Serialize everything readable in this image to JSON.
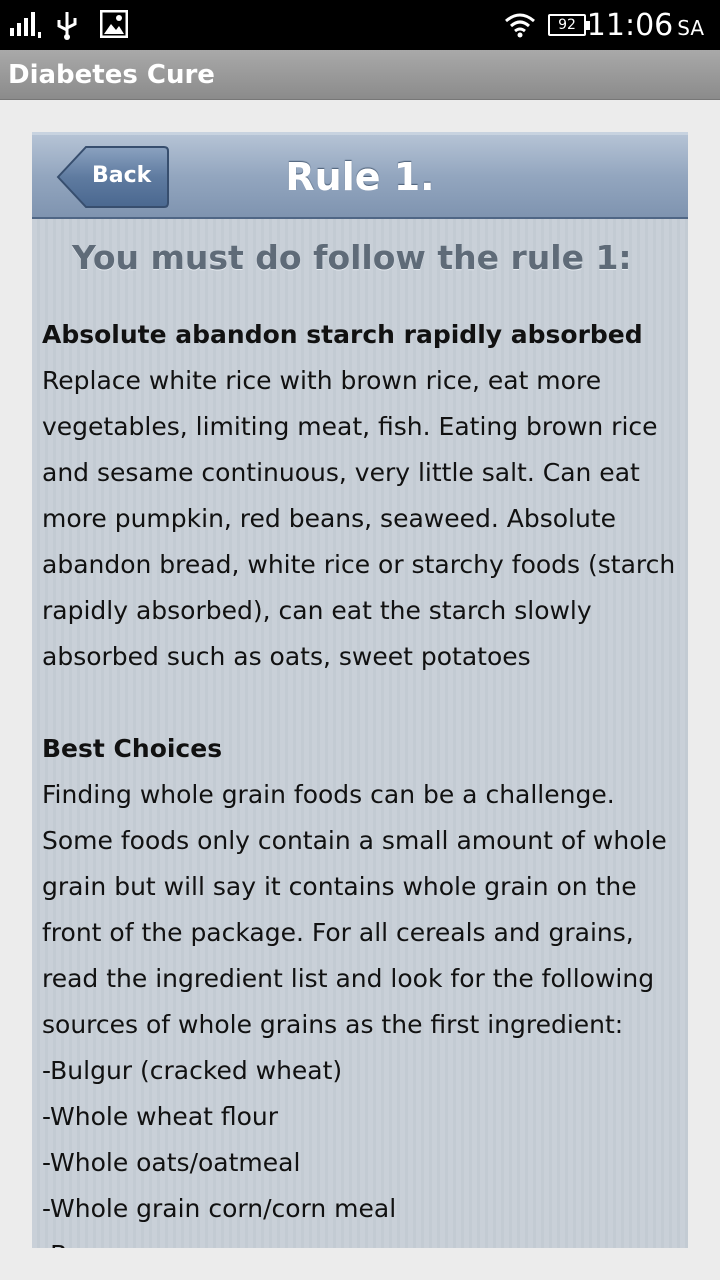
{
  "status_bar": {
    "battery": "92",
    "time": "11:06",
    "ampm": "SA",
    "icons": [
      "signal-icon",
      "usb-icon",
      "image-icon",
      "wifi-icon",
      "battery-icon"
    ]
  },
  "app_bar": {
    "title": "Diabetes Cure"
  },
  "nav": {
    "back_label": "Back",
    "title": "Rule 1."
  },
  "subheading": "You must do follow the rule 1:",
  "sections": [
    {
      "title": "Absolute abandon starch rapidly absorbed",
      "body": "Replace white rice with brown rice, eat more vegetables, limiting meat, fish. Eating brown rice and sesame continuous, very little salt. Can eat more pumpkin, red beans, seaweed. Absolute abandon bread, white rice or starchy foods (starch rapidly absorbed), can eat the starch slowly absorbed such as oats, sweet potatoes"
    },
    {
      "title": "Best Choices",
      "body": "Finding whole grain foods can be a challenge. Some foods only contain a small amount of whole grain but will say it contains whole grain on the front of the package. For all cereals and grains, read the ingredient list and look for the following sources of whole grains as the first ingredient:",
      "items": [
        "-Bulgur (cracked wheat)",
        "-Whole wheat flour",
        "-Whole oats/oatmeal",
        "-Whole grain corn/corn meal",
        "-B"
      ]
    }
  ]
}
